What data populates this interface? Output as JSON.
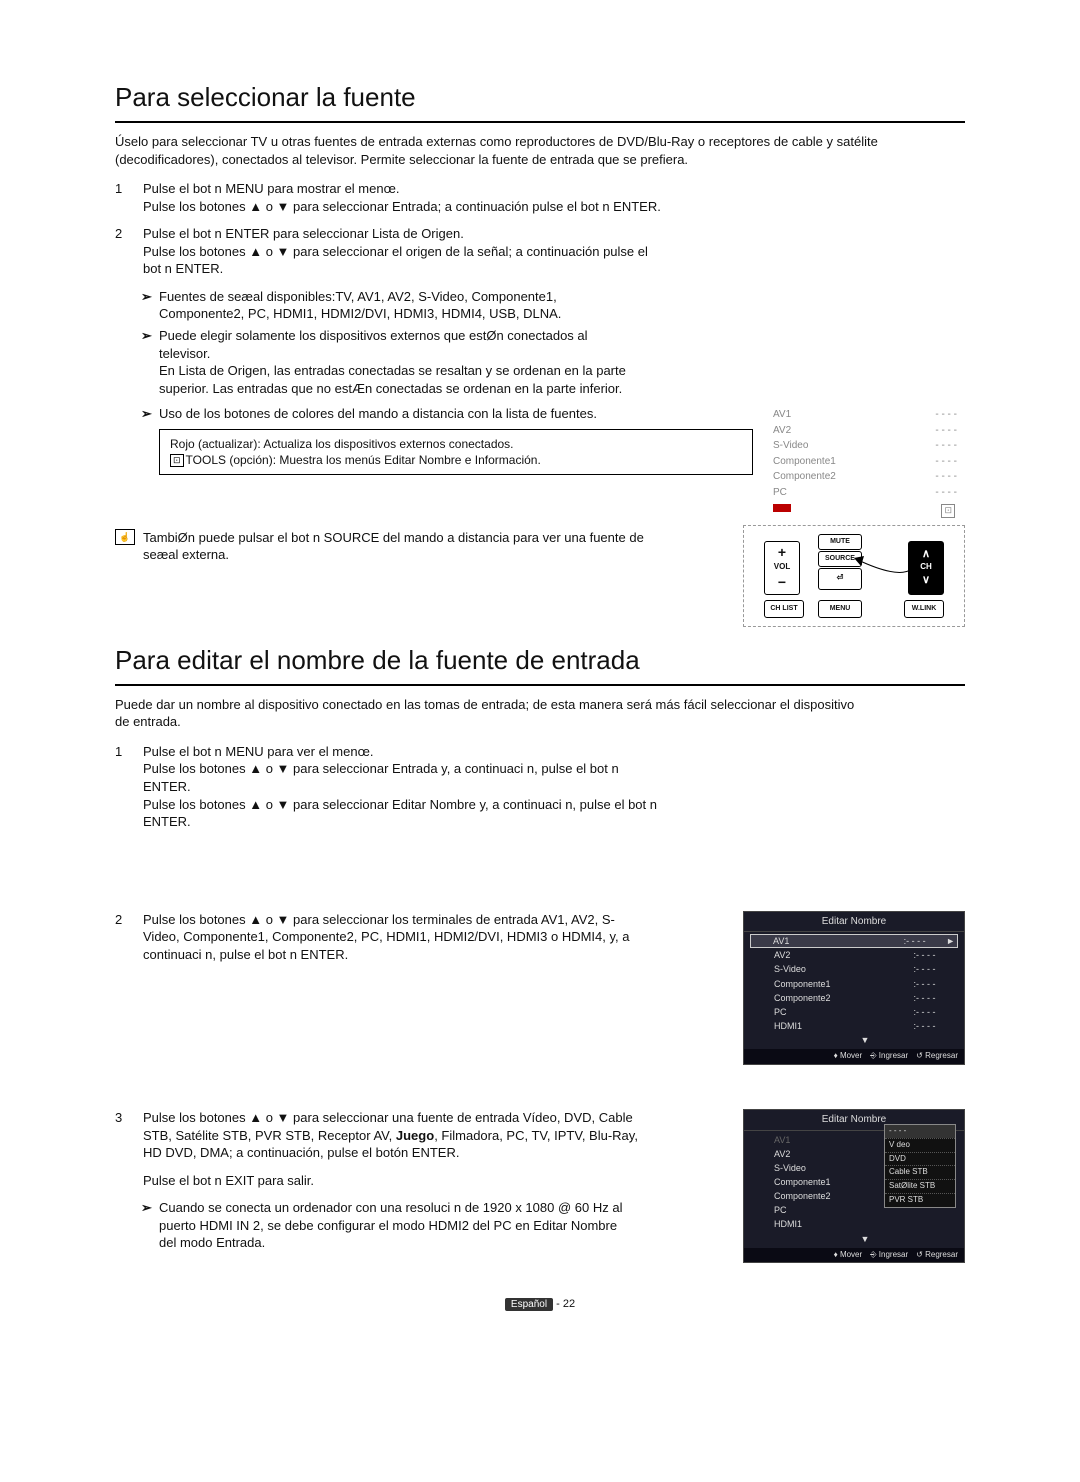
{
  "section1": {
    "heading": "Para seleccionar la fuente",
    "intro": "Úselo para seleccionar TV u otras fuentes de entrada externas como reproductores de DVD/Blu-Ray o receptores de cable y satélite (decodificadores), conectados al televisor. Permite seleccionar la fuente de entrada que se prefiera.",
    "steps": {
      "s1_num": "1",
      "s1_l1": "Pulse el bot n  MENU para mostrar el menœ.",
      "s1_l2": "Pulse los botones ▲ o ▼ para seleccionar Entrada; a continuación pulse el bot n  ENTER.",
      "s2_num": "2",
      "s2_l1": "Pulse el bot n  ENTER para seleccionar Lista de Origen.",
      "s2_l2": "Pulse los botones ▲ o ▼ para seleccionar el origen de la señal; a continuación pulse el bot n  ENTER.",
      "sub1": "Fuentes de seæal disponibles:TV, AV1, AV2, S-Video, Componente1, Componente2, PC, HDMI1, HDMI2/DVI, HDMI3, HDMI4, USB, DLNA.",
      "sub2": "Puede elegir solamente los dispositivos externos que estØn conectados al televisor.",
      "sub2b": "En Lista de Origen, las entradas conectadas se resaltan y se ordenan en la parte superior. Las entradas que no estÆn conectadas se ordenan en la parte inferior.",
      "sub3": "Uso de los botones de colores del mando a distancia con la lista de fuentes.",
      "note_l1": "Rojo (actualizar): Actualiza los dispositivos externos conectados.",
      "note_l2": "TOOLS (opción): Muestra los menús Editar Nombre e Información.",
      "icon_note": "TambiØn puede pulsar el bot n SOURCE del mando a distancia para ver una fuente de seæal externa."
    },
    "osd_list": {
      "r1": "AV1",
      "r2": "AV2",
      "r3": "S-Video",
      "r4": "Componente1",
      "r5": "Componente2",
      "r6": "PC",
      "dash": "- - - -"
    },
    "remote": {
      "mute": "MUTE",
      "vol": "VOL",
      "source": "SOURCE",
      "ch": "CH",
      "chlist": "CH LIST",
      "menu": "MENU",
      "wlink": "W.LINK"
    }
  },
  "section2": {
    "heading": "Para editar el nombre de la fuente de entrada",
    "intro": "Puede dar un nombre al dispositivo conectado en las tomas de entrada; de esta manera será más fácil seleccionar el dispositivo de entrada.",
    "steps": {
      "s1_num": "1",
      "s1_l1": "Pulse el bot n  MENU para ver el menœ.",
      "s1_l2": "Pulse los botones ▲ o ▼ para seleccionar Entrada y, a continuaci n, pulse el bot n  ENTER.",
      "s1_l3": "Pulse los botones ▲ o ▼ para seleccionar Editar Nombre y, a continuaci n, pulse el bot n  ENTER.",
      "s2_num": "2",
      "s2_body": "Pulse los botones ▲ o ▼ para seleccionar los terminales de entrada AV1, AV2, S-Video, Componente1, Componente2, PC, HDMI1, HDMI2/DVI, HDMI3 o HDMI4, y, a continuaci n, pulse el bot n  ENTER.",
      "s3_num": "3",
      "s3_l1a": "Pulse los botones ▲ o ▼ para seleccionar una fuente de entrada Vídeo, DVD, Cable STB, Satélite STB, PVR STB, Receptor AV, ",
      "s3_l1b": "Juego",
      "s3_l1c": ", Filmadora, PC, TV, IPTV, Blu-Ray, HD DVD, DMA; a continuación, pulse el botón ENTER.",
      "s3_l2": "Pulse el bot n  EXIT para salir.",
      "sub1": "Cuando se conecta un ordenador con una resoluci n de 1920 x 1080  @ 60 Hz al puerto HDMI IN 2, se debe configurar el modo HDMI2 del PC en Editar Nombre del modo Entrada."
    },
    "osd1": {
      "title": "Editar Nombre",
      "rows": [
        "AV1",
        "AV2",
        "S-Video",
        "Componente1",
        "Componente2",
        "PC",
        "HDMI1"
      ],
      "colon": ":",
      "dash": "- - - -",
      "tri": "►",
      "more": "▼",
      "f_mover": "Mover",
      "f_ingresar": "Ingresar",
      "f_regresar": "Regresar"
    },
    "osd2": {
      "title": "Editar Nombre",
      "rows": [
        "AV1",
        "AV2",
        "S-Video",
        "Componente1",
        "Componente2",
        "PC",
        "HDMI1"
      ],
      "popup": [
        "- - - -",
        "V deo",
        "DVD",
        "Cable STB",
        "SatØlite STB",
        "PVR STB"
      ],
      "more": "▼",
      "f_mover": "Mover",
      "f_ingresar": "Ingresar",
      "f_regresar": "Regresar"
    }
  },
  "footer": {
    "label": "Español",
    "page": "22"
  },
  "bullet": "➢"
}
